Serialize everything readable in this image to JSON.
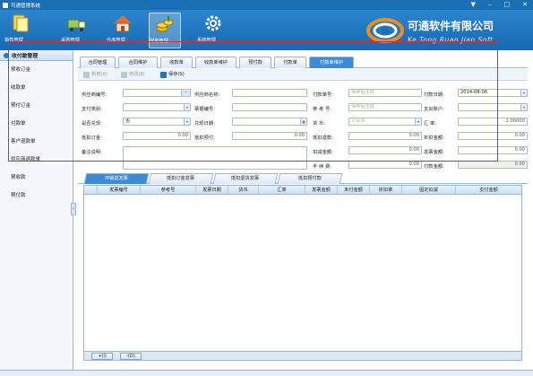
{
  "window": {
    "title": "可通管理系统",
    "controls": [
      "▼",
      "–",
      "□",
      "✕"
    ]
  },
  "nav": {
    "items": [
      {
        "label": "销售管理",
        "icon": "sales-document-icon",
        "color": "#f4c430"
      },
      {
        "label": "采购管理",
        "icon": "purchase-truck-icon",
        "color": "#8fc14a"
      },
      {
        "label": "仓库管理",
        "icon": "warehouse-house-icon",
        "color": "#e76b3b"
      },
      {
        "label": "财务管理",
        "icon": "finance-coins-icon",
        "color": "#f2c200"
      },
      {
        "label": "系统管理",
        "icon": "system-gear-icon",
        "color": "#ffffff"
      }
    ],
    "active_index": 3
  },
  "logo": {
    "company_name": "可通软件有限公司",
    "english_name": "Ke Tong Ruan Jian Soft"
  },
  "sidebar": {
    "header": "收付款管理",
    "items": [
      "预收订金",
      "收款单",
      "预付订金",
      "付款单",
      "客户退款单",
      "供应商退款单",
      "预收款",
      "预付款"
    ],
    "collapse_glyph": "‹"
  },
  "tabs": [
    "合同管理",
    "合同维护",
    "收款单",
    "收款单维护",
    "预付款",
    "付款单",
    "付款单维护"
  ],
  "active_tab": "付款单维护",
  "toolbar": {
    "new_label": "新增(A)",
    "edit_label": "修改(E)",
    "save_label": "保存(S)"
  },
  "form": {
    "supplier_code_label": "供应商编号:",
    "supplier_name_label": "供应商名称:",
    "payment_no_label": "付款单号:",
    "payment_no_placeholder": "保存后生成",
    "payment_date_label": "付款日期:",
    "payment_date_value": "2014-08-06",
    "payment_type_label": "支付类别:",
    "invoice_no_label": "票据编号:",
    "ref_no_label": "参 考 号:",
    "ref_no_placeholder": "保存后生成",
    "payee_account_label": "支出账户:",
    "cashed_label": "是否兑现:",
    "cashed_value": "否",
    "cash_date_label": "兑现日期:",
    "currency_label": "货    币:",
    "currency_value": "人民币",
    "exchange_rate_label": "汇    率:",
    "exchange_rate_value": "1.00000",
    "offset_deposit_label": "抵扣订金:",
    "offset_deposit_value": "0.00",
    "offset_prepay_label": "抵扣预付:",
    "offset_prepay_value": "0.00",
    "offset_refund_label": "抵扣退款:",
    "offset_refund_value": "0.00",
    "discount_amount_label": "折扣金额:",
    "discount_amount_value": "0.00",
    "remark_label": "备注说明:",
    "deduct_amount_label": "扣减金额:",
    "deduct_amount_value": "0.00",
    "invoice_amount_label": "发票金额:",
    "invoice_amount_value": "0.00",
    "handling_fee_label": "手 续 费:",
    "handling_fee_value": "0.00",
    "payment_amount_label": "付款金额:",
    "payment_amount_value": "0.00"
  },
  "subtabs": [
    "冲销进发票",
    "抵扣订金发票",
    "抵扣退货发票",
    "抵扣预付款"
  ],
  "active_subtab": "冲销进发票",
  "grid": {
    "columns": [
      "发票编号",
      "参考号",
      "发票日期",
      "货币",
      "汇率",
      "发票金额",
      "未付金额",
      "折扣率",
      "固定扣减",
      "支付金额"
    ]
  },
  "grid_buttons": {
    "add_label": "+(I)",
    "remove_label": "-(D)"
  }
}
